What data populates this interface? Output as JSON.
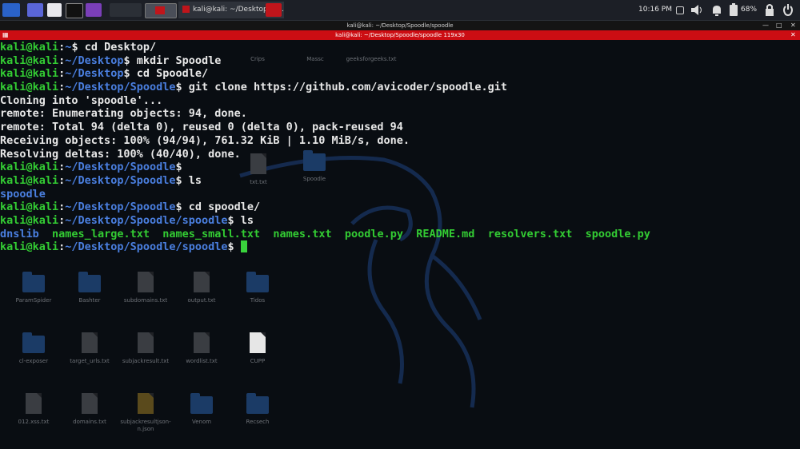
{
  "taskbar": {
    "running_task": "kali@kali: ~/Desktop/Sp...",
    "clock": "10:16 PM",
    "battery": "68%"
  },
  "terminal": {
    "window_title": "kali@kali: ~/Desktop/Spoodle/spoodle",
    "tab_title": "kali@kali: ~/Desktop/Spoodle/spoodle 119x30",
    "lines": [
      {
        "user": "kali@kali",
        "path": "~",
        "cmd": "cd Desktop/"
      },
      {
        "user": "kali@kali",
        "path": "~/Desktop",
        "cmd": "mkdir Spoodle"
      },
      {
        "user": "kali@kali",
        "path": "~/Desktop",
        "cmd": "cd Spoodle/"
      },
      {
        "user": "kali@kali",
        "path": "~/Desktop/Spoodle",
        "cmd": "git clone https://github.com/avicoder/spoodle.git"
      },
      {
        "out": "Cloning into 'spoodle'..."
      },
      {
        "out": "remote: Enumerating objects: 94, done."
      },
      {
        "out": "remote: Total 94 (delta 0), reused 0 (delta 0), pack-reused 94"
      },
      {
        "out": "Receiving objects: 100% (94/94), 761.32 KiB | 1.10 MiB/s, done."
      },
      {
        "out": "Resolving deltas: 100% (40/40), done."
      },
      {
        "user": "kali@kali",
        "path": "~/Desktop/Spoodle",
        "cmd": ""
      },
      {
        "user": "kali@kali",
        "path": "~/Desktop/Spoodle",
        "cmd": "ls"
      },
      {
        "dir": "spoodle"
      },
      {
        "user": "kali@kali",
        "path": "~/Desktop/Spoodle",
        "cmd": "cd spoodle/"
      },
      {
        "user": "kali@kali",
        "path": "~/Desktop/Spoodle/spoodle",
        "cmd": "ls"
      },
      {
        "listing": [
          {
            "name": "dnslib",
            "kind": "dir"
          },
          {
            "name": "names_large.txt",
            "kind": "file"
          },
          {
            "name": "names_small.txt",
            "kind": "file"
          },
          {
            "name": "names.txt",
            "kind": "file"
          },
          {
            "name": "poodle.py",
            "kind": "file"
          },
          {
            "name": "README.md",
            "kind": "file"
          },
          {
            "name": "resolvers.txt",
            "kind": "file"
          },
          {
            "name": "spoodle.py",
            "kind": "file"
          }
        ]
      },
      {
        "user": "kali@kali",
        "path": "~/Desktop/Spoodle/spoodle",
        "cmd": "",
        "cursor": true
      }
    ]
  },
  "desktop": {
    "icons": [
      {
        "label": "Crips",
        "type": "folder"
      },
      {
        "label": "Massc",
        "type": "folder"
      },
      {
        "label": "geeksforgeeks.txt",
        "type": "file"
      },
      {
        "label": "txt.txt",
        "type": "file"
      },
      {
        "label": "Spoodle",
        "type": "folder"
      },
      {
        "label": "ParamSpider",
        "type": "folder"
      },
      {
        "label": "Bashter",
        "type": "folder"
      },
      {
        "label": "subdomains.txt",
        "type": "file"
      },
      {
        "label": "output.txt",
        "type": "file"
      },
      {
        "label": "Tidos",
        "type": "folder"
      },
      {
        "label": "cl-exposer",
        "type": "folder"
      },
      {
        "label": "target_urls.txt",
        "type": "file"
      },
      {
        "label": "subjackresult.txt",
        "type": "file"
      },
      {
        "label": "wordlist.txt",
        "type": "file"
      },
      {
        "label": "CUPP",
        "type": "folder"
      },
      {
        "label": "012.xss.txt",
        "type": "file"
      },
      {
        "label": "domains.txt",
        "type": "file"
      },
      {
        "label": "subjackresultjson-n.json",
        "type": "json"
      },
      {
        "label": "Venom",
        "type": "folder"
      },
      {
        "label": "Recsech",
        "type": "folder"
      }
    ]
  }
}
